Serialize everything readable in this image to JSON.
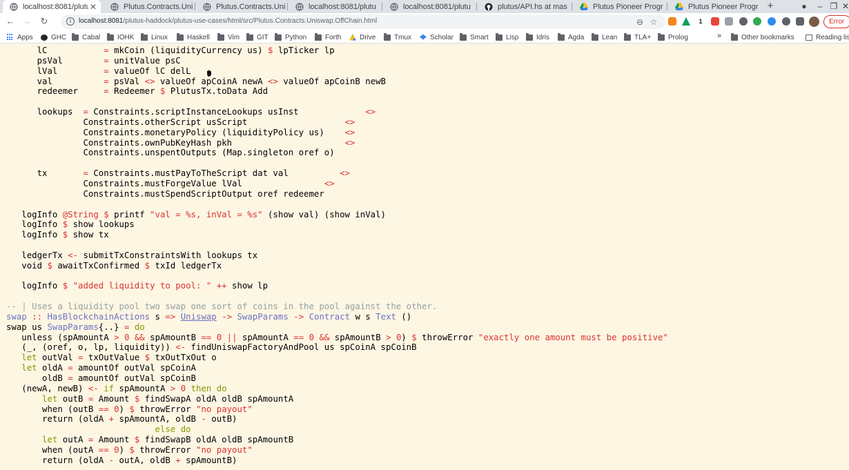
{
  "tabs": [
    {
      "title": "localhost:8081/plutu",
      "icon": "globe-icon",
      "active": true,
      "closable": true
    },
    {
      "title": "Plutus.Contracts.Unis",
      "icon": "globe-icon",
      "active": false,
      "closable": false
    },
    {
      "title": "Plutus.Contracts.Unis",
      "icon": "globe-icon",
      "active": false,
      "closable": false
    },
    {
      "title": "localhost:8081/plutu",
      "icon": "globe-icon",
      "active": false,
      "closable": false
    },
    {
      "title": "localhost:8081/plutu",
      "icon": "globe-icon",
      "active": false,
      "closable": false
    },
    {
      "title": "plutus/API.hs at mas",
      "icon": "github-icon",
      "active": false,
      "closable": false
    },
    {
      "title": "Plutus Pioneer Progr",
      "icon": "google-drive-icon",
      "active": false,
      "closable": false
    },
    {
      "title": "Plutus Pioneer Progr",
      "icon": "google-drive-icon",
      "active": false,
      "closable": false
    }
  ],
  "window": {
    "minimize": "–",
    "restore": "❐",
    "close": "✕",
    "newtab": "+",
    "record": "●"
  },
  "toolbar": {
    "back": "←",
    "forward": "→",
    "reload": "↻",
    "url_host": "localhost:8081",
    "url_path": "/plutus-haddock/plutus-use-cases/html/src/Plutus.Contracts.Uniswap.OffChain.html",
    "zoom": "⊖",
    "star": "☆",
    "extensions": [
      "metamask-icon",
      "drive-icon",
      "one-icon",
      "puzzle-piece-icon"
    ],
    "ext_one": "1",
    "error_label": "Error"
  },
  "bookmarks": [
    {
      "label": "Apps",
      "icon": "apps-icon"
    },
    {
      "label": "GHC",
      "icon": "github-icon"
    },
    {
      "label": "Cabal",
      "icon": "folder-icon"
    },
    {
      "label": "IOHK",
      "icon": "folder-icon"
    },
    {
      "label": "Linux",
      "icon": "folder-icon"
    },
    {
      "label": "Haskell",
      "icon": "folder-icon"
    },
    {
      "label": "Vim",
      "icon": "folder-icon"
    },
    {
      "label": "GIT",
      "icon": "folder-icon"
    },
    {
      "label": "Python",
      "icon": "folder-icon"
    },
    {
      "label": "Forth",
      "icon": "folder-icon"
    },
    {
      "label": "Drive",
      "icon": "google-drive-icon"
    },
    {
      "label": "Tmux",
      "icon": "folder-icon"
    },
    {
      "label": "Scholar",
      "icon": "scholar-icon"
    },
    {
      "label": "Smart",
      "icon": "folder-icon"
    },
    {
      "label": "Lisp",
      "icon": "folder-icon"
    },
    {
      "label": "Idris",
      "icon": "folder-icon"
    },
    {
      "label": "Agda",
      "icon": "folder-icon"
    },
    {
      "label": "Lean",
      "icon": "folder-icon"
    },
    {
      "label": "TLA+",
      "icon": "folder-icon"
    },
    {
      "label": "Prolog",
      "icon": "folder-icon"
    }
  ],
  "bookmarks_overflow": "»",
  "bookmarks_right": [
    {
      "label": "Other bookmarks",
      "icon": "folder-icon"
    },
    {
      "label": "Reading lis",
      "icon": "reading-list-icon"
    }
  ],
  "code_lines": [
    [
      [
        "      lC           ",
        ""
      ],
      [
        "=",
        "op"
      ],
      [
        " mkCoin (liquidityCurrency us) ",
        ""
      ],
      [
        "$",
        "op"
      ],
      [
        " lpTicker lp",
        ""
      ]
    ],
    [
      [
        "      psVal        ",
        ""
      ],
      [
        "=",
        "op"
      ],
      [
        " unitValue psC",
        ""
      ]
    ],
    [
      [
        "      lVal         ",
        ""
      ],
      [
        "=",
        "op"
      ],
      [
        " valueOf lC delL",
        ""
      ]
    ],
    [
      [
        "      val          ",
        ""
      ],
      [
        "=",
        "op"
      ],
      [
        " psVal ",
        ""
      ],
      [
        "<>",
        "op"
      ],
      [
        " valueOf apCoinA newA ",
        ""
      ],
      [
        "<>",
        "op"
      ],
      [
        " valueOf apCoinB newB",
        ""
      ]
    ],
    [
      [
        "      redeemer     ",
        ""
      ],
      [
        "=",
        "op"
      ],
      [
        " Redeemer ",
        ""
      ],
      [
        "$",
        "op"
      ],
      [
        " PlutusTx.toData Add",
        ""
      ]
    ],
    [
      [
        "",
        ""
      ]
    ],
    [
      [
        "      lookups  ",
        ""
      ],
      [
        "=",
        "op"
      ],
      [
        " Constraints.scriptInstanceLookups usInst             ",
        ""
      ],
      [
        "<>",
        "op"
      ]
    ],
    [
      [
        "               Constraints.otherScript usScript                   ",
        ""
      ],
      [
        "<>",
        "op"
      ]
    ],
    [
      [
        "               Constraints.monetaryPolicy (liquidityPolicy us)    ",
        ""
      ],
      [
        "<>",
        "op"
      ]
    ],
    [
      [
        "               Constraints.ownPubKeyHash pkh                      ",
        ""
      ],
      [
        "<>",
        "op"
      ]
    ],
    [
      [
        "               Constraints.unspentOutputs (Map.singleton oref o)",
        ""
      ]
    ],
    [
      [
        "",
        ""
      ]
    ],
    [
      [
        "      tx       ",
        ""
      ],
      [
        "=",
        "op"
      ],
      [
        " Constraints.mustPayToTheScript dat val          ",
        ""
      ],
      [
        "<>",
        "op"
      ]
    ],
    [
      [
        "               Constraints.mustForgeValue lVal                ",
        ""
      ],
      [
        "<>",
        "op"
      ]
    ],
    [
      [
        "               Constraints.mustSpendScriptOutput oref redeemer",
        ""
      ]
    ],
    [
      [
        "",
        ""
      ]
    ],
    [
      [
        "   logInfo ",
        ""
      ],
      [
        "@String",
        "op"
      ],
      [
        " ",
        ""
      ],
      [
        "$",
        "op"
      ],
      [
        " printf ",
        ""
      ],
      [
        "\"val = %s, inVal = %s\"",
        "str"
      ],
      [
        " (show val) (show inVal)",
        ""
      ]
    ],
    [
      [
        "   logInfo ",
        ""
      ],
      [
        "$",
        "op"
      ],
      [
        " show lookups",
        ""
      ]
    ],
    [
      [
        "   logInfo ",
        ""
      ],
      [
        "$",
        "op"
      ],
      [
        " show tx",
        ""
      ]
    ],
    [
      [
        "",
        ""
      ]
    ],
    [
      [
        "   ledgerTx ",
        ""
      ],
      [
        "<-",
        "op"
      ],
      [
        " submitTxConstraintsWith lookups tx",
        ""
      ]
    ],
    [
      [
        "   void ",
        ""
      ],
      [
        "$",
        "op"
      ],
      [
        " awaitTxConfirmed ",
        ""
      ],
      [
        "$",
        "op"
      ],
      [
        " txId ledgerTx",
        ""
      ]
    ],
    [
      [
        "",
        ""
      ]
    ],
    [
      [
        "   logInfo ",
        ""
      ],
      [
        "$",
        "op"
      ],
      [
        " ",
        ""
      ],
      [
        "\"added liquidity to pool: \"",
        "str"
      ],
      [
        " ",
        ""
      ],
      [
        "++",
        "op"
      ],
      [
        " show lp",
        ""
      ]
    ],
    [
      [
        "",
        ""
      ]
    ],
    [
      [
        "-- | Uses a liquidity pool two swap one sort of coins in the pool against the other.",
        "cm"
      ]
    ],
    [
      [
        "swap",
        "ty"
      ],
      [
        " :: ",
        "op"
      ],
      [
        "HasBlockchainActions",
        "ty"
      ],
      [
        " s ",
        ""
      ],
      [
        "=>",
        "op"
      ],
      [
        " ",
        ""
      ],
      [
        "Uniswap",
        "tyul"
      ],
      [
        " ",
        ""
      ],
      [
        "->",
        "op"
      ],
      [
        " ",
        ""
      ],
      [
        "SwapParams",
        "ty"
      ],
      [
        " ",
        ""
      ],
      [
        "->",
        "op"
      ],
      [
        " ",
        ""
      ],
      [
        "Contract",
        "ty"
      ],
      [
        " w s ",
        ""
      ],
      [
        "Text",
        "ty"
      ],
      [
        " ()",
        ""
      ]
    ],
    [
      [
        "swap us ",
        ""
      ],
      [
        "SwapParams",
        "ty"
      ],
      [
        "{..}",
        ""
      ],
      [
        " = ",
        "op"
      ],
      [
        "do",
        "kw"
      ]
    ],
    [
      [
        "   unless (spAmountA ",
        ""
      ],
      [
        ">",
        "op"
      ],
      [
        " ",
        ""
      ],
      [
        "0",
        "num"
      ],
      [
        " ",
        ""
      ],
      [
        "&&",
        "op"
      ],
      [
        " spAmountB ",
        ""
      ],
      [
        "==",
        "op"
      ],
      [
        " ",
        ""
      ],
      [
        "0",
        "num"
      ],
      [
        " ",
        ""
      ],
      [
        "||",
        "op"
      ],
      [
        " spAmountA ",
        ""
      ],
      [
        "==",
        "op"
      ],
      [
        " ",
        ""
      ],
      [
        "0",
        "num"
      ],
      [
        " ",
        ""
      ],
      [
        "&&",
        "op"
      ],
      [
        " spAmountB ",
        ""
      ],
      [
        ">",
        "op"
      ],
      [
        " ",
        ""
      ],
      [
        "0",
        "num"
      ],
      [
        ") ",
        ""
      ],
      [
        "$",
        "op"
      ],
      [
        " throwError ",
        ""
      ],
      [
        "\"exactly one amount must be positive\"",
        "str"
      ]
    ],
    [
      [
        "   (_, (oref, o, lp, liquidity)) ",
        ""
      ],
      [
        "<-",
        "op"
      ],
      [
        " findUniswapFactoryAndPool us spCoinA spCoinB",
        ""
      ]
    ],
    [
      [
        "   ",
        ""
      ],
      [
        "let",
        "kw"
      ],
      [
        " outVal ",
        ""
      ],
      [
        "=",
        "op"
      ],
      [
        " txOutValue ",
        ""
      ],
      [
        "$",
        "op"
      ],
      [
        " txOutTxOut o",
        ""
      ]
    ],
    [
      [
        "   ",
        ""
      ],
      [
        "let",
        "kw"
      ],
      [
        " oldA ",
        ""
      ],
      [
        "=",
        "op"
      ],
      [
        " amountOf outVal spCoinA",
        ""
      ]
    ],
    [
      [
        "       oldB ",
        ""
      ],
      [
        "=",
        "op"
      ],
      [
        " amountOf outVal spCoinB",
        ""
      ]
    ],
    [
      [
        "   (newA, newB) ",
        ""
      ],
      [
        "<-",
        "op"
      ],
      [
        " ",
        ""
      ],
      [
        "if",
        "kw"
      ],
      [
        " spAmountA ",
        ""
      ],
      [
        ">",
        "op"
      ],
      [
        " ",
        ""
      ],
      [
        "0",
        "num"
      ],
      [
        " ",
        ""
      ],
      [
        "then",
        "kw"
      ],
      [
        " ",
        ""
      ],
      [
        "do",
        "kw"
      ]
    ],
    [
      [
        "       ",
        ""
      ],
      [
        "let",
        "kw"
      ],
      [
        " outB ",
        ""
      ],
      [
        "=",
        "op"
      ],
      [
        " Amount ",
        ""
      ],
      [
        "$",
        "op"
      ],
      [
        " findSwapA oldA oldB spAmountA",
        ""
      ]
    ],
    [
      [
        "       when (outB ",
        ""
      ],
      [
        "==",
        "op"
      ],
      [
        " ",
        ""
      ],
      [
        "0",
        "num"
      ],
      [
        ") ",
        ""
      ],
      [
        "$",
        "op"
      ],
      [
        " throwError ",
        ""
      ],
      [
        "\"no payout\"",
        "str"
      ]
    ],
    [
      [
        "       return (oldA ",
        ""
      ],
      [
        "+",
        "op"
      ],
      [
        " spAmountA, oldB ",
        ""
      ],
      [
        "-",
        "op"
      ],
      [
        " outB)",
        ""
      ]
    ],
    [
      [
        "                             ",
        ""
      ],
      [
        "else",
        "kw"
      ],
      [
        " ",
        ""
      ],
      [
        "do",
        "kw"
      ]
    ],
    [
      [
        "       ",
        ""
      ],
      [
        "let",
        "kw"
      ],
      [
        " outA ",
        ""
      ],
      [
        "=",
        "op"
      ],
      [
        " Amount ",
        ""
      ],
      [
        "$",
        "op"
      ],
      [
        " findSwapB oldA oldB spAmountB",
        ""
      ]
    ],
    [
      [
        "       when (outA ",
        ""
      ],
      [
        "==",
        "op"
      ],
      [
        " ",
        ""
      ],
      [
        "0",
        "num"
      ],
      [
        ") ",
        ""
      ],
      [
        "$",
        "op"
      ],
      [
        " throwError ",
        ""
      ],
      [
        "\"no payout\"",
        "str"
      ]
    ],
    [
      [
        "       return (oldA ",
        ""
      ],
      [
        "-",
        "op"
      ],
      [
        " outA, oldB ",
        ""
      ],
      [
        "+",
        "op"
      ],
      [
        " spAmountB)",
        ""
      ]
    ]
  ],
  "colors": {
    "background": "#fdf6e3",
    "operator": "#dc322f",
    "keyword": "#859900",
    "type": "#6c71c4",
    "comment": "#93a1a1"
  }
}
